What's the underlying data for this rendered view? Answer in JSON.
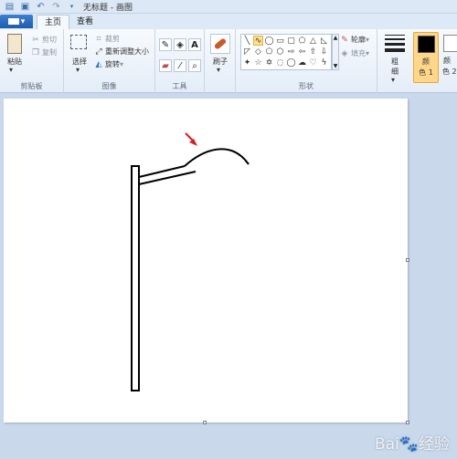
{
  "window": {
    "title": "无标题 - 画图"
  },
  "tabs": [
    {
      "label": "主页",
      "active": true
    },
    {
      "label": "查看",
      "active": false
    }
  ],
  "clipboard": {
    "paste": "粘贴",
    "cut": "剪切",
    "copy": "复制",
    "group": "剪贴板"
  },
  "image": {
    "select": "选择",
    "crop": "裁剪",
    "resize": "重新调整大小",
    "rotate": "旋转",
    "group": "图像"
  },
  "tools": {
    "group": "工具",
    "text_icon": "A"
  },
  "brushes": {
    "label": "刷子"
  },
  "shapes": {
    "outline": "轮廓",
    "fill": "填充",
    "group": "形状"
  },
  "size": {
    "label_line1": "粗",
    "label_line2": "细"
  },
  "colors": {
    "color1_line1": "颜",
    "color1_line2": "色 1",
    "color2_line1": "颜",
    "color2_line2": "色 2",
    "color1_value": "#000000",
    "color2_value": "#ffffff"
  },
  "watermark": "Bai🐾经验",
  "accent": "#3d7fd1",
  "drawing": {
    "description_icons": [
      "pole",
      "lamp-arm",
      "lamp-head-curve",
      "red-arrow"
    ]
  }
}
